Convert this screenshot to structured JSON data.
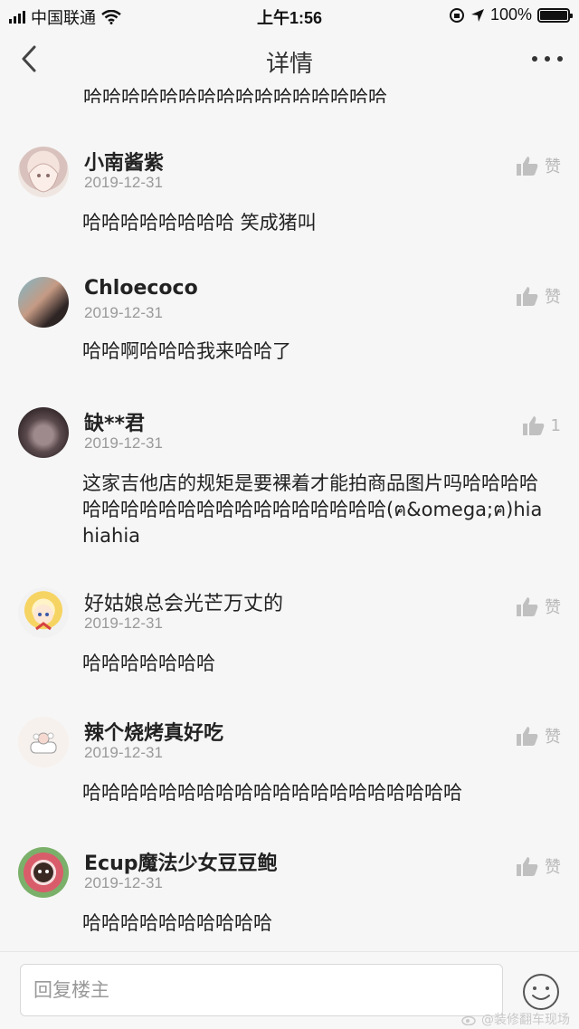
{
  "status_bar": {
    "carrier": "中国联通",
    "time": "上午1:56",
    "battery": "100%"
  },
  "nav": {
    "title": "详情"
  },
  "partial_text": "哈哈哈哈哈哈哈哈哈哈哈哈哈哈哈哈",
  "comments": [
    {
      "user": "小南酱紫",
      "date": "2019-12-31",
      "like": "赞",
      "body": "哈哈哈哈哈哈哈哈 笑成猪叫"
    },
    {
      "user": "Chloecoco",
      "date": "2019-12-31",
      "like": "赞",
      "body": "哈哈啊哈哈哈我来哈哈了"
    },
    {
      "user": "缺**君",
      "date": "2019-12-31",
      "like": "1",
      "body": "这家吉他店的规矩是要裸着才能拍商品图片吗哈哈哈哈哈哈哈哈哈哈哈哈哈哈哈哈哈哈哈哈(ฅ&omega;ฅ)hiahiahia"
    },
    {
      "user": "好姑娘总会光芒万丈的",
      "date": "2019-12-31",
      "like": "赞",
      "body": "哈哈哈哈哈哈哈"
    },
    {
      "user": "辣个烧烤真好吃",
      "date": "2019-12-31",
      "like": "赞",
      "body": "哈哈哈哈哈哈哈哈哈哈哈哈哈哈哈哈哈哈哈哈"
    },
    {
      "user": "Ecup魔法少女豆豆鲍",
      "date": "2019-12-31",
      "like": "赞",
      "body": "哈哈哈哈哈哈哈哈哈哈"
    }
  ],
  "reply": {
    "placeholder": "回复楼主"
  },
  "watermark": "@装修翻车现场"
}
